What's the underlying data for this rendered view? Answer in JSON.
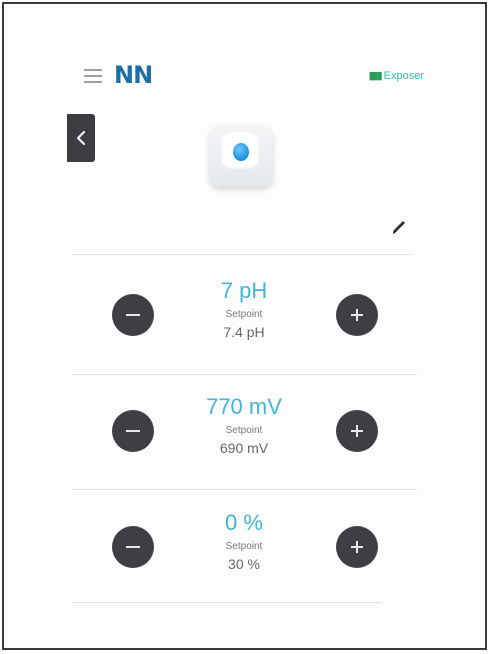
{
  "header": {
    "logo": "NN",
    "status_text": "Exposer",
    "status_icon": "signal-icon"
  },
  "icons": {
    "menu": "menu-icon",
    "back": "chevron-left-icon",
    "edit": "pencil-icon",
    "minus": "minus-icon",
    "plus": "plus-icon"
  },
  "colors": {
    "brand": "#1d6fa8",
    "reading": "#41b6d6",
    "status": "#33b8a5",
    "button": "#3d3f44"
  },
  "rows": [
    {
      "reading": "7 pH",
      "setpoint_label": "Setpoint",
      "setpoint_value": "7.4 pH"
    },
    {
      "reading": "770 mV",
      "setpoint_label": "Setpoint",
      "setpoint_value": "690 mV"
    },
    {
      "reading": "0 %",
      "setpoint_label": "Setpoint",
      "setpoint_value": "30 %"
    }
  ]
}
